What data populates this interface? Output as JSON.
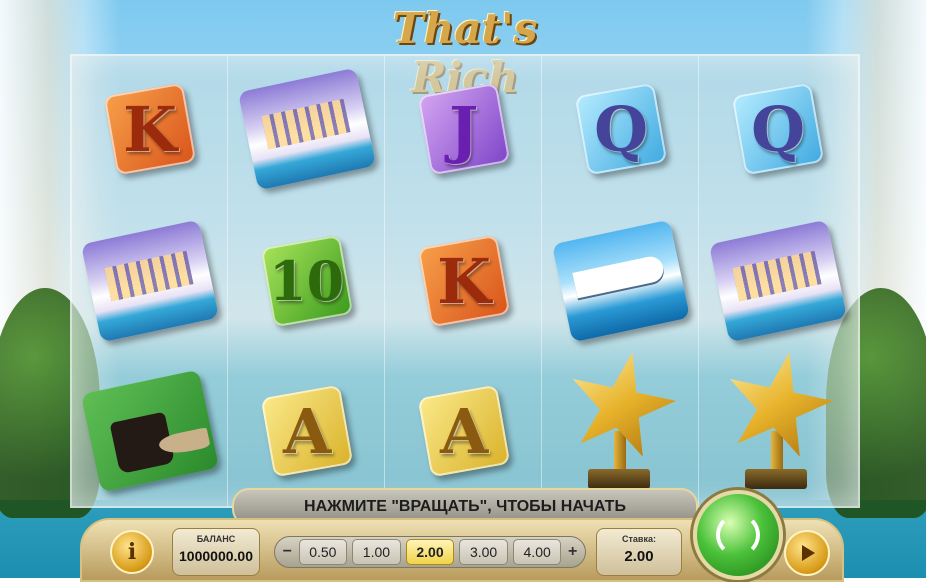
{
  "game": {
    "logo_text": "That's Rich"
  },
  "reels": [
    {
      "symbols": [
        {
          "kind": "card",
          "label": "K",
          "color": "orange"
        },
        {
          "kind": "picture",
          "label": "villa"
        },
        {
          "kind": "picture",
          "label": "handbag"
        }
      ]
    },
    {
      "symbols": [
        {
          "kind": "picture",
          "label": "villa"
        },
        {
          "kind": "card",
          "label": "10",
          "color": "green"
        },
        {
          "kind": "card",
          "label": "A",
          "color": "yellow"
        }
      ]
    },
    {
      "symbols": [
        {
          "kind": "card",
          "label": "J",
          "color": "purple"
        },
        {
          "kind": "card",
          "label": "K",
          "color": "orange"
        },
        {
          "kind": "card",
          "label": "A",
          "color": "yellow"
        }
      ]
    },
    {
      "symbols": [
        {
          "kind": "card",
          "label": "Q",
          "color": "blue"
        },
        {
          "kind": "picture",
          "label": "yacht"
        },
        {
          "kind": "picture",
          "label": "star-trophy"
        }
      ]
    },
    {
      "symbols": [
        {
          "kind": "card",
          "label": "Q",
          "color": "blue"
        },
        {
          "kind": "picture",
          "label": "villa"
        },
        {
          "kind": "picture",
          "label": "star-trophy"
        }
      ]
    }
  ],
  "message": "НАЖМИТЕ \"ВРАЩАТЬ\", ЧТОБЫ НАЧАТЬ",
  "controls": {
    "info_icon": "i",
    "balance_label": "БАЛАНС",
    "balance_value": "1000000.00",
    "minus": "−",
    "plus": "+",
    "bet_options": [
      "0.50",
      "1.00",
      "2.00",
      "3.00",
      "4.00"
    ],
    "selected_bet": "2.00",
    "stake_label": "Ставка:",
    "stake_value": "2.00"
  }
}
